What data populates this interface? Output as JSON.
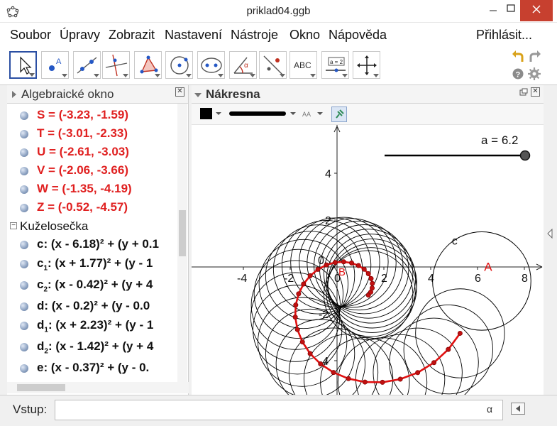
{
  "window": {
    "title": "priklad04.ggb",
    "controls": {
      "minimize": "—",
      "maximize": "□",
      "close": "✕"
    }
  },
  "menu": {
    "items": [
      "Soubor",
      "Úpravy",
      "Zobrazit",
      "Nastavení",
      "Nástroje",
      "Okno",
      "Nápověda"
    ],
    "login": "Přihlásit..."
  },
  "toolbar": {
    "tools": [
      {
        "icon": "move-arrow-icon",
        "active": true
      },
      {
        "icon": "new-point-icon",
        "label": "A"
      },
      {
        "icon": "line-through-two-points-icon"
      },
      {
        "icon": "perpendicular-line-icon"
      },
      {
        "icon": "polygon-icon"
      },
      {
        "icon": "circle-center-point-icon"
      },
      {
        "icon": "ellipse-icon"
      },
      {
        "icon": "angle-icon",
        "label": "α"
      },
      {
        "icon": "reflect-about-line-icon"
      },
      {
        "icon": "text-icon",
        "label": "ABC"
      },
      {
        "icon": "slider-icon",
        "label": "a = 2"
      },
      {
        "icon": "move-graphics-view-icon"
      }
    ],
    "right_icons": [
      "undo-icon",
      "redo-icon",
      "help-icon",
      "settings-icon"
    ]
  },
  "algebra": {
    "title": "Algebraické okno",
    "points": [
      {
        "text": "S = (-3.23, -1.59)"
      },
      {
        "text": "T = (-3.01, -2.33)"
      },
      {
        "text": "U = (-2.61, -3.03)"
      },
      {
        "text": "V = (-2.06, -3.66)"
      },
      {
        "text": "W = (-1.35, -4.19)"
      },
      {
        "text": "Z = (-0.52, -4.57)"
      }
    ],
    "group": "Kuželosečka",
    "conics": [
      {
        "name": "c",
        "sub": "",
        "eq": ": (x - 6.18)² + (y + 0.1"
      },
      {
        "name": "c",
        "sub": "1",
        "eq": ": (x + 1.77)² + (y - 1"
      },
      {
        "name": "c",
        "sub": "2",
        "eq": ": (x - 0.42)² + (y + 4"
      },
      {
        "name": "d",
        "sub": "",
        "eq": ": (x - 0.2)² + (y - 0.0"
      },
      {
        "name": "d",
        "sub": "1",
        "eq": ": (x + 2.23)² + (y - 1"
      },
      {
        "name": "d",
        "sub": "2",
        "eq": ": (x - 1.42)² + (y + 4"
      },
      {
        "name": "e",
        "sub": "",
        "eq": ": (x - 0.37)² + (y - 0."
      }
    ]
  },
  "graphics": {
    "title": "Nákresna",
    "slider": {
      "label": "a = 6.2",
      "value": 6.2
    },
    "x_ticks": [
      "-4",
      "-2",
      "0",
      "2",
      "4",
      "6",
      "8"
    ],
    "y_ticks": [
      "4",
      "2",
      "-2",
      "-4"
    ],
    "labels": {
      "point_A": "A",
      "point_B": "B",
      "circle_c": "c",
      "origin": "0"
    },
    "colors": {
      "spiral": "#e01010",
      "point": "#c01010",
      "circles": "#000000"
    }
  },
  "input": {
    "label": "Vstup:",
    "value": "",
    "alpha": "α"
  }
}
